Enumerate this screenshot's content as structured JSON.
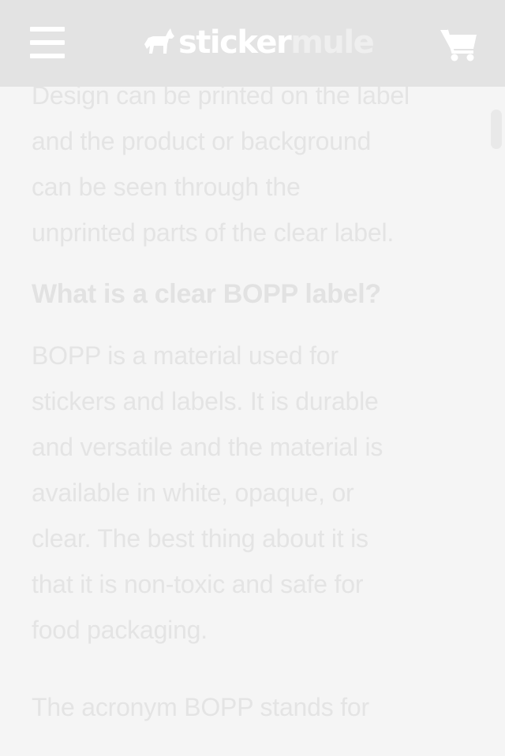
{
  "header": {
    "logo": {
      "part1": "sticker",
      "part2": "mule"
    },
    "menu_icon": "hamburger-menu-icon",
    "cart_icon": "shopping-cart-icon",
    "background": "#e3e3e3"
  },
  "article": {
    "intro_lines": [
      "Design can be printed on the label",
      "and the product or background",
      "can be seen through the",
      "unprinted parts of the clear label."
    ],
    "heading": "What is a clear BOPP label?",
    "paragraph1_lines": [
      "BOPP is a material used for",
      "stickers and labels. It is durable",
      "and versatile and the material is",
      "available in white, opaque, or",
      "clear. The best thing about it is",
      "that it is non-toxic and safe for",
      "food packaging."
    ],
    "paragraph2_lines": [
      "The acronym BOPP stands for"
    ]
  },
  "colors": {
    "text": "#e4e4e4",
    "page_background": "#f5f5f5"
  }
}
